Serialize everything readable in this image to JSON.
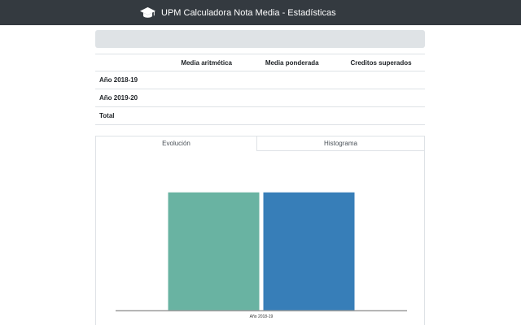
{
  "header": {
    "title": "UPM Calculadora Nota Media - Estadísticas",
    "icon": "graduation-cap-icon",
    "background": "#343a40"
  },
  "table": {
    "columns": [
      "",
      "Media aritmética",
      "Media ponderada",
      "Creditos superados"
    ],
    "rows": [
      {
        "label": "Año 2018-19",
        "values": [
          "",
          "",
          ""
        ]
      },
      {
        "label": "Año 2019-20",
        "values": [
          "",
          "",
          ""
        ]
      },
      {
        "label": "Total",
        "values": [
          "",
          "",
          ""
        ]
      }
    ]
  },
  "tabs": [
    {
      "label": "Evolución",
      "active": true
    },
    {
      "label": "Histograma",
      "active": false
    }
  ],
  "chart_data": {
    "type": "bar",
    "categories": [
      "Año 2018-19"
    ],
    "series": [
      {
        "values": [
          1
        ],
        "color": "#69b3a2"
      },
      {
        "values": [
          1
        ],
        "color": "#377eb8"
      }
    ],
    "ylim": [
      0,
      1.15
    ],
    "grid": false
  }
}
